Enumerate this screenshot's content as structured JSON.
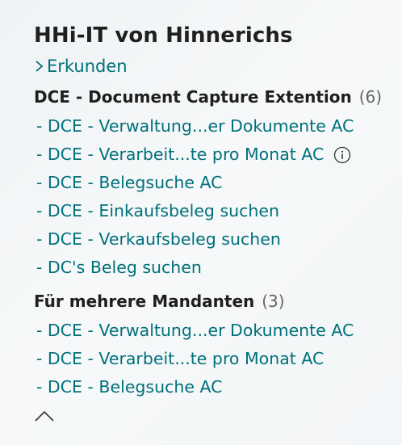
{
  "header": {
    "title": "HHi-IT von Hinnerichs",
    "explore_label": "Erkunden"
  },
  "groups": [
    {
      "title": "DCE - Document Capture Extention",
      "count": "(6)",
      "items": [
        {
          "label": "- DCE - Verwaltung...er Dokumente AC"
        },
        {
          "label": "- DCE - Verarbeit...te pro Monat AC"
        },
        {
          "label": "- DCE - Belegsuche AC"
        },
        {
          "label": "- DCE - Einkaufsbeleg suchen"
        },
        {
          "label": "- DCE - Verkaufsbeleg suchen"
        },
        {
          "label": "- DC's Beleg suchen"
        }
      ]
    },
    {
      "title": "Für mehrere Mandanten",
      "count": "(3)",
      "items": [
        {
          "label": "- DCE - Verwaltung...er Dokumente AC"
        },
        {
          "label": "- DCE - Verarbeit...te pro Monat AC"
        },
        {
          "label": "- DCE - Belegsuche AC"
        }
      ]
    }
  ],
  "icons": {
    "explore": "chevron-right-icon",
    "info": "info-icon",
    "collapse": "chevron-up-icon"
  },
  "colors": {
    "link": "#00707a",
    "text": "#1f1f1f",
    "muted": "#666666"
  }
}
